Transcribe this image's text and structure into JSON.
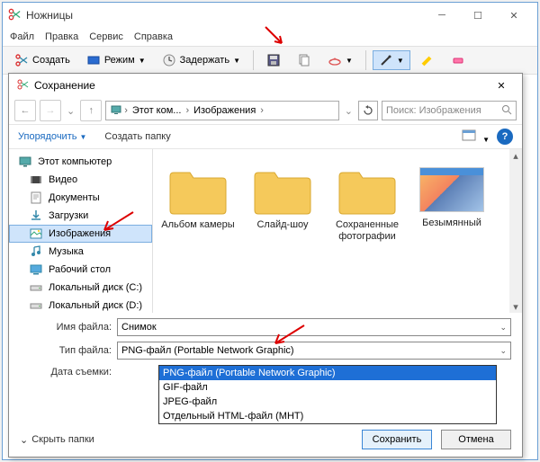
{
  "window": {
    "title": "Ножницы",
    "menu": {
      "file": "Файл",
      "edit": "Правка",
      "service": "Сервис",
      "help": "Справка"
    },
    "toolbar": {
      "new": "Создать",
      "mode": "Режим",
      "delay": "Задержать"
    }
  },
  "dialog": {
    "title": "Сохранение",
    "breadcrumb": {
      "root": "Этот ком...",
      "folder": "Изображения"
    },
    "search_placeholder": "Поиск: Изображения",
    "organize": "Упорядочить",
    "new_folder": "Создать папку",
    "sidebar": {
      "this_pc": "Этот компьютер",
      "video": "Видео",
      "documents": "Документы",
      "downloads": "Загрузки",
      "pictures": "Изображения",
      "music": "Музыка",
      "desktop": "Рабочий стол",
      "disk_c": "Локальный диск (C:)",
      "disk_d": "Локальный диск (D:)"
    },
    "files": {
      "camera": "Альбом камеры",
      "slideshow": "Слайд-шоу",
      "saved": "Сохраненные фотографии",
      "untitled": "Безымянный"
    },
    "form": {
      "name_label": "Имя файла:",
      "name_value": "Снимок",
      "type_label": "Тип файла:",
      "type_value": "PNG-файл (Portable Network Graphic)",
      "date_label": "Дата съемки:",
      "options": {
        "png": "PNG-файл (Portable Network Graphic)",
        "gif": "GIF-файл",
        "jpeg": "JPEG-файл",
        "mht": "Отдельный HTML-файл (MHT)"
      }
    },
    "hide_folders": "Скрыть папки",
    "save_btn": "Сохранить",
    "cancel_btn": "Отмена"
  }
}
